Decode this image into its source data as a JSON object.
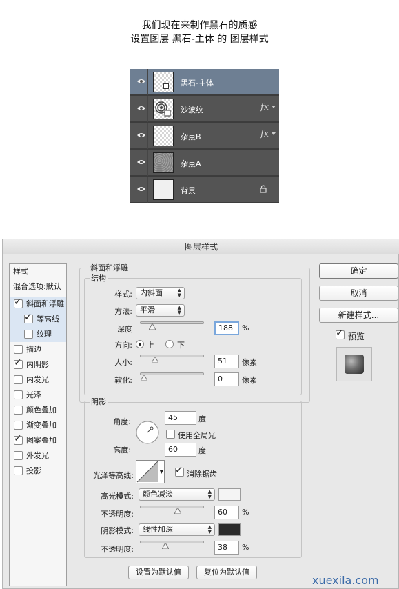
{
  "heading": {
    "line1": "我们现在来制作黑石的质感",
    "line2": "设置图层 黑石-主体 的 图层样式"
  },
  "layers": [
    {
      "name": "黑石-主体",
      "selected": true,
      "thumb": "transparent-mask",
      "fx": false,
      "lock": false
    },
    {
      "name": "沙波纹",
      "selected": false,
      "thumb": "swirl",
      "fx": true,
      "lock": false
    },
    {
      "name": "杂点B",
      "selected": false,
      "thumb": "transparent",
      "fx": true,
      "lock": false
    },
    {
      "name": "杂点A",
      "selected": false,
      "thumb": "noise",
      "fx": false,
      "lock": false
    },
    {
      "name": "背景",
      "selected": false,
      "thumb": "white",
      "fx": false,
      "lock": true
    }
  ],
  "layers_ui": {
    "fx_symbol": "fx",
    "eye_icon": "eye-icon",
    "lock_icon": "lock-icon"
  },
  "dialog": {
    "title": "图层样式",
    "sidebar": {
      "header": "样式",
      "blend": "混合选项:默认",
      "items": [
        {
          "label": "斜面和浮雕",
          "checked": true,
          "highlight": true
        },
        {
          "label": "等高线",
          "checked": true,
          "highlight": true
        },
        {
          "label": "纹理",
          "checked": false,
          "highlight": true
        },
        {
          "label": "描边",
          "checked": false,
          "highlight": false
        },
        {
          "label": "内阴影",
          "checked": true,
          "highlight": false
        },
        {
          "label": "内发光",
          "checked": false,
          "highlight": false
        },
        {
          "label": "光泽",
          "checked": false,
          "highlight": false
        },
        {
          "label": "颜色叠加",
          "checked": false,
          "highlight": false
        },
        {
          "label": "渐变叠加",
          "checked": false,
          "highlight": false
        },
        {
          "label": "图案叠加",
          "checked": true,
          "highlight": false
        },
        {
          "label": "外发光",
          "checked": false,
          "highlight": false
        },
        {
          "label": "投影",
          "checked": false,
          "highlight": false
        }
      ]
    },
    "bevel": {
      "section": "斜面和浮雕",
      "structure": "结构",
      "style_label": "样式:",
      "style_value": "内斜面",
      "method_label": "方法:",
      "method_value": "平滑",
      "depth_label": "深度",
      "depth_value": "188",
      "depth_unit": "%",
      "depth_slider": 0.15,
      "direction_label": "方向:",
      "dir_up": "上",
      "dir_down": "下",
      "direction_selected": "上",
      "size_label": "大小:",
      "size_value": "51",
      "size_unit": "像素",
      "size_slider": 0.2,
      "soften_label": "软化:",
      "soften_value": "0",
      "soften_unit": "像素",
      "soften_slider": 0
    },
    "shading": {
      "section": "阴影",
      "angle_label": "角度:",
      "angle_value": "45",
      "angle_unit": "度",
      "global_light_label": "使用全局光",
      "global_light_checked": false,
      "altitude_label": "高度:",
      "altitude_value": "60",
      "altitude_unit": "度",
      "gloss_label": "光泽等高线:",
      "antialias_label": "消除锯齿",
      "antialias_checked": true,
      "highlight_mode_label": "高光模式:",
      "highlight_mode": "颜色减淡",
      "highlight_color": "#f4f4f4",
      "highlight_opacity_label": "不透明度:",
      "highlight_opacity": "60",
      "highlight_opacity_unit": "%",
      "highlight_slider": 0.6,
      "shadow_mode_label": "阴影模式:",
      "shadow_mode": "线性加深",
      "shadow_color": "#2b2b2b",
      "shadow_opacity_label": "不透明度:",
      "shadow_opacity": "38",
      "shadow_opacity_unit": "%",
      "shadow_slider": 0.38
    },
    "buttons": {
      "make_default": "设置为默认值",
      "reset_default": "复位为默认值",
      "ok": "确定",
      "cancel": "取消",
      "new_style": "新建样式...",
      "preview": "预览",
      "preview_checked": true
    }
  },
  "watermark": "xuexila.com"
}
